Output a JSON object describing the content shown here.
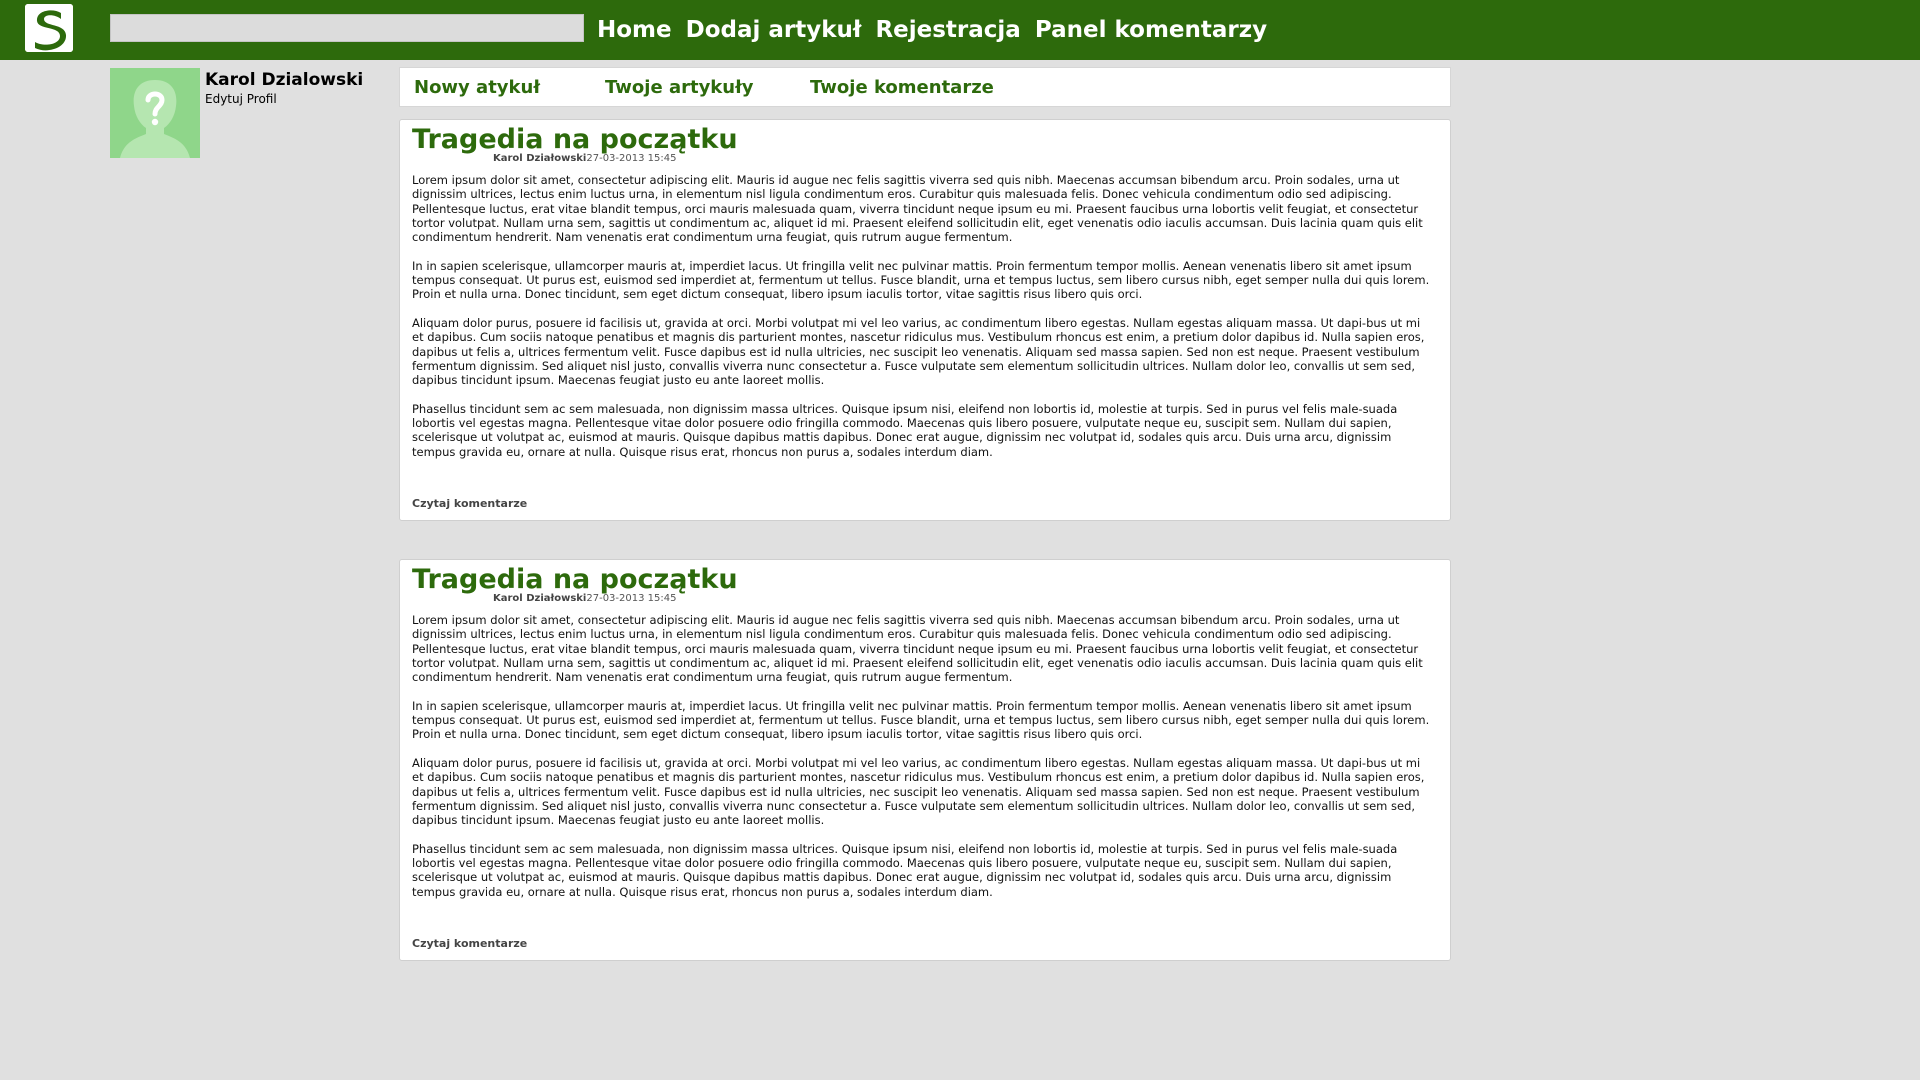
{
  "header": {
    "logo_letter": "S",
    "search": {
      "value": "",
      "placeholder": ""
    },
    "nav": [
      "Home",
      "Dodaj artykuł",
      "Rejestracja",
      "Panel komentarzy"
    ]
  },
  "profile": {
    "avatar_icon": "unknown-user-icon",
    "name": "Karol Dzialowski",
    "edit_label": "Edytuj Profil"
  },
  "subnav": [
    "Nowy atykuł",
    "Twoje artykuły",
    "Twoje komentarze"
  ],
  "articles": [
    {
      "title": "Tragedia na początku",
      "author": "Karol Działowski",
      "date": "27-03-2013 15:45",
      "paragraphs": [
        "Lorem ipsum dolor sit amet, consectetur adipiscing elit. Mauris id augue nec felis sagittis viverra sed quis nibh. Maecenas accumsan bibendum arcu. Proin sodales, urna ut dignissim ultrices, lectus enim luctus urna, in elementum nisl ligula condimentum eros. Curabitur quis malesuada felis. Donec vehicula condimentum odio sed adipiscing. Pellentesque luctus, erat vitae blandit tempus, orci mauris malesuada quam, viverra tincidunt neque ipsum eu mi. Praesent faucibus urna lobortis velit feugiat, et consectetur tortor volutpat. Nullam urna sem, sagittis ut condimentum ac, aliquet id mi. Praesent eleifend sollicitudin elit, eget venenatis odio iaculis accumsan. Duis lacinia quam quis elit condimentum hendrerit. Nam venenatis erat condimentum urna feugiat, quis rutrum augue fermentum.",
        "In in sapien scelerisque, ullamcorper mauris at, imperdiet lacus. Ut fringilla velit nec pulvinar mattis. Proin fermentum tempor mollis. Aenean venenatis libero sit amet ipsum tempus consequat. Ut purus est, euismod sed imperdiet at, fermentum ut tellus. Fusce blandit, urna et tempus luctus, sem libero cursus nibh, eget semper nulla dui quis lorem. Proin et nulla urna. Donec tincidunt, sem eget dictum consequat, libero ipsum iaculis tortor, vitae sagittis risus libero quis orci.",
        "Aliquam dolor purus, posuere id facilisis ut, gravida at orci. Morbi volutpat mi vel leo varius, ac condimentum libero egestas. Nullam egestas aliquam massa. Ut dapi-bus ut mi et dapibus. Cum sociis natoque penatibus et magnis dis parturient montes, nascetur ridiculus mus. Vestibulum rhoncus est enim, a pretium dolor dapibus id. Nulla sapien eros, dapibus ut felis a, ultrices fermentum velit. Fusce dapibus est id nulla ultricies, nec suscipit leo venenatis. Aliquam sed massa sapien. Sed non est neque. Praesent vestibulum fermentum dignissim. Sed aliquet nisl justo, convallis viverra nunc consectetur a. Fusce vulputate sem elementum sollicitudin ultrices. Nullam dolor leo, convallis ut sem sed, dapibus tincidunt ipsum. Maecenas feugiat justo eu ante laoreet mollis.",
        "Phasellus tincidunt sem ac sem malesuada, non dignissim massa ultrices. Quisque ipsum nisi, eleifend non lobortis id, molestie at turpis. Sed in purus vel felis male-suada lobortis vel egestas magna. Pellentesque vitae dolor posuere odio fringilla commodo. Maecenas quis libero posuere, vulputate neque eu, suscipit sem. Nullam dui sapien, scelerisque ut volutpat ac, euismod at mauris. Quisque dapibus mattis dapibus. Donec erat augue, dignissim nec volutpat id, sodales quis arcu. Duis urna arcu, dignissim tempus gravida eu, ornare at nulla. Quisque risus erat, rhoncus non purus a, sodales interdum diam."
      ],
      "comments_label": "Czytaj komentarze"
    },
    {
      "title": "Tragedia na początku",
      "author": "Karol Działowski",
      "date": "27-03-2013 15:45",
      "paragraphs": [
        "Lorem ipsum dolor sit amet, consectetur adipiscing elit. Mauris id augue nec felis sagittis viverra sed quis nibh. Maecenas accumsan bibendum arcu. Proin sodales, urna ut dignissim ultrices, lectus enim luctus urna, in elementum nisl ligula condimentum eros. Curabitur quis malesuada felis. Donec vehicula condimentum odio sed adipiscing. Pellentesque luctus, erat vitae blandit tempus, orci mauris malesuada quam, viverra tincidunt neque ipsum eu mi. Praesent faucibus urna lobortis velit feugiat, et consectetur tortor volutpat. Nullam urna sem, sagittis ut condimentum ac, aliquet id mi. Praesent eleifend sollicitudin elit, eget venenatis odio iaculis accumsan. Duis lacinia quam quis elit condimentum hendrerit. Nam venenatis erat condimentum urna feugiat, quis rutrum augue fermentum.",
        "In in sapien scelerisque, ullamcorper mauris at, imperdiet lacus. Ut fringilla velit nec pulvinar mattis. Proin fermentum tempor mollis. Aenean venenatis libero sit amet ipsum tempus consequat. Ut purus est, euismod sed imperdiet at, fermentum ut tellus. Fusce blandit, urna et tempus luctus, sem libero cursus nibh, eget semper nulla dui quis lorem. Proin et nulla urna. Donec tincidunt, sem eget dictum consequat, libero ipsum iaculis tortor, vitae sagittis risus libero quis orci.",
        "Aliquam dolor purus, posuere id facilisis ut, gravida at orci. Morbi volutpat mi vel leo varius, ac condimentum libero egestas. Nullam egestas aliquam massa. Ut dapi-bus ut mi et dapibus. Cum sociis natoque penatibus et magnis dis parturient montes, nascetur ridiculus mus. Vestibulum rhoncus est enim, a pretium dolor dapibus id. Nulla sapien eros, dapibus ut felis a, ultrices fermentum velit. Fusce dapibus est id nulla ultricies, nec suscipit leo venenatis. Aliquam sed massa sapien. Sed non est neque. Praesent vestibulum fermentum dignissim. Sed aliquet nisl justo, convallis viverra nunc consectetur a. Fusce vulputate sem elementum sollicitudin ultrices. Nullam dolor leo, convallis ut sem sed, dapibus tincidunt ipsum. Maecenas feugiat justo eu ante laoreet mollis.",
        "Phasellus tincidunt sem ac sem malesuada, non dignissim massa ultrices. Quisque ipsum nisi, eleifend non lobortis id, molestie at turpis. Sed in purus vel felis male-suada lobortis vel egestas magna. Pellentesque vitae dolor posuere odio fringilla commodo. Maecenas quis libero posuere, vulputate neque eu, suscipit sem. Nullam dui sapien, scelerisque ut volutpat ac, euismod at mauris. Quisque dapibus mattis dapibus. Donec erat augue, dignissim nec volutpat id, sodales quis arcu. Duis urna arcu, dignissim tempus gravida eu, ornare at nulla. Quisque risus erat, rhoncus non purus a, sodales interdum diam."
      ],
      "comments_label": "Czytaj komentarze"
    }
  ],
  "colors": {
    "brand_green": "#2d6a0c",
    "page_background": "#e0e0e0",
    "avatar_green": "#8fd68a"
  }
}
